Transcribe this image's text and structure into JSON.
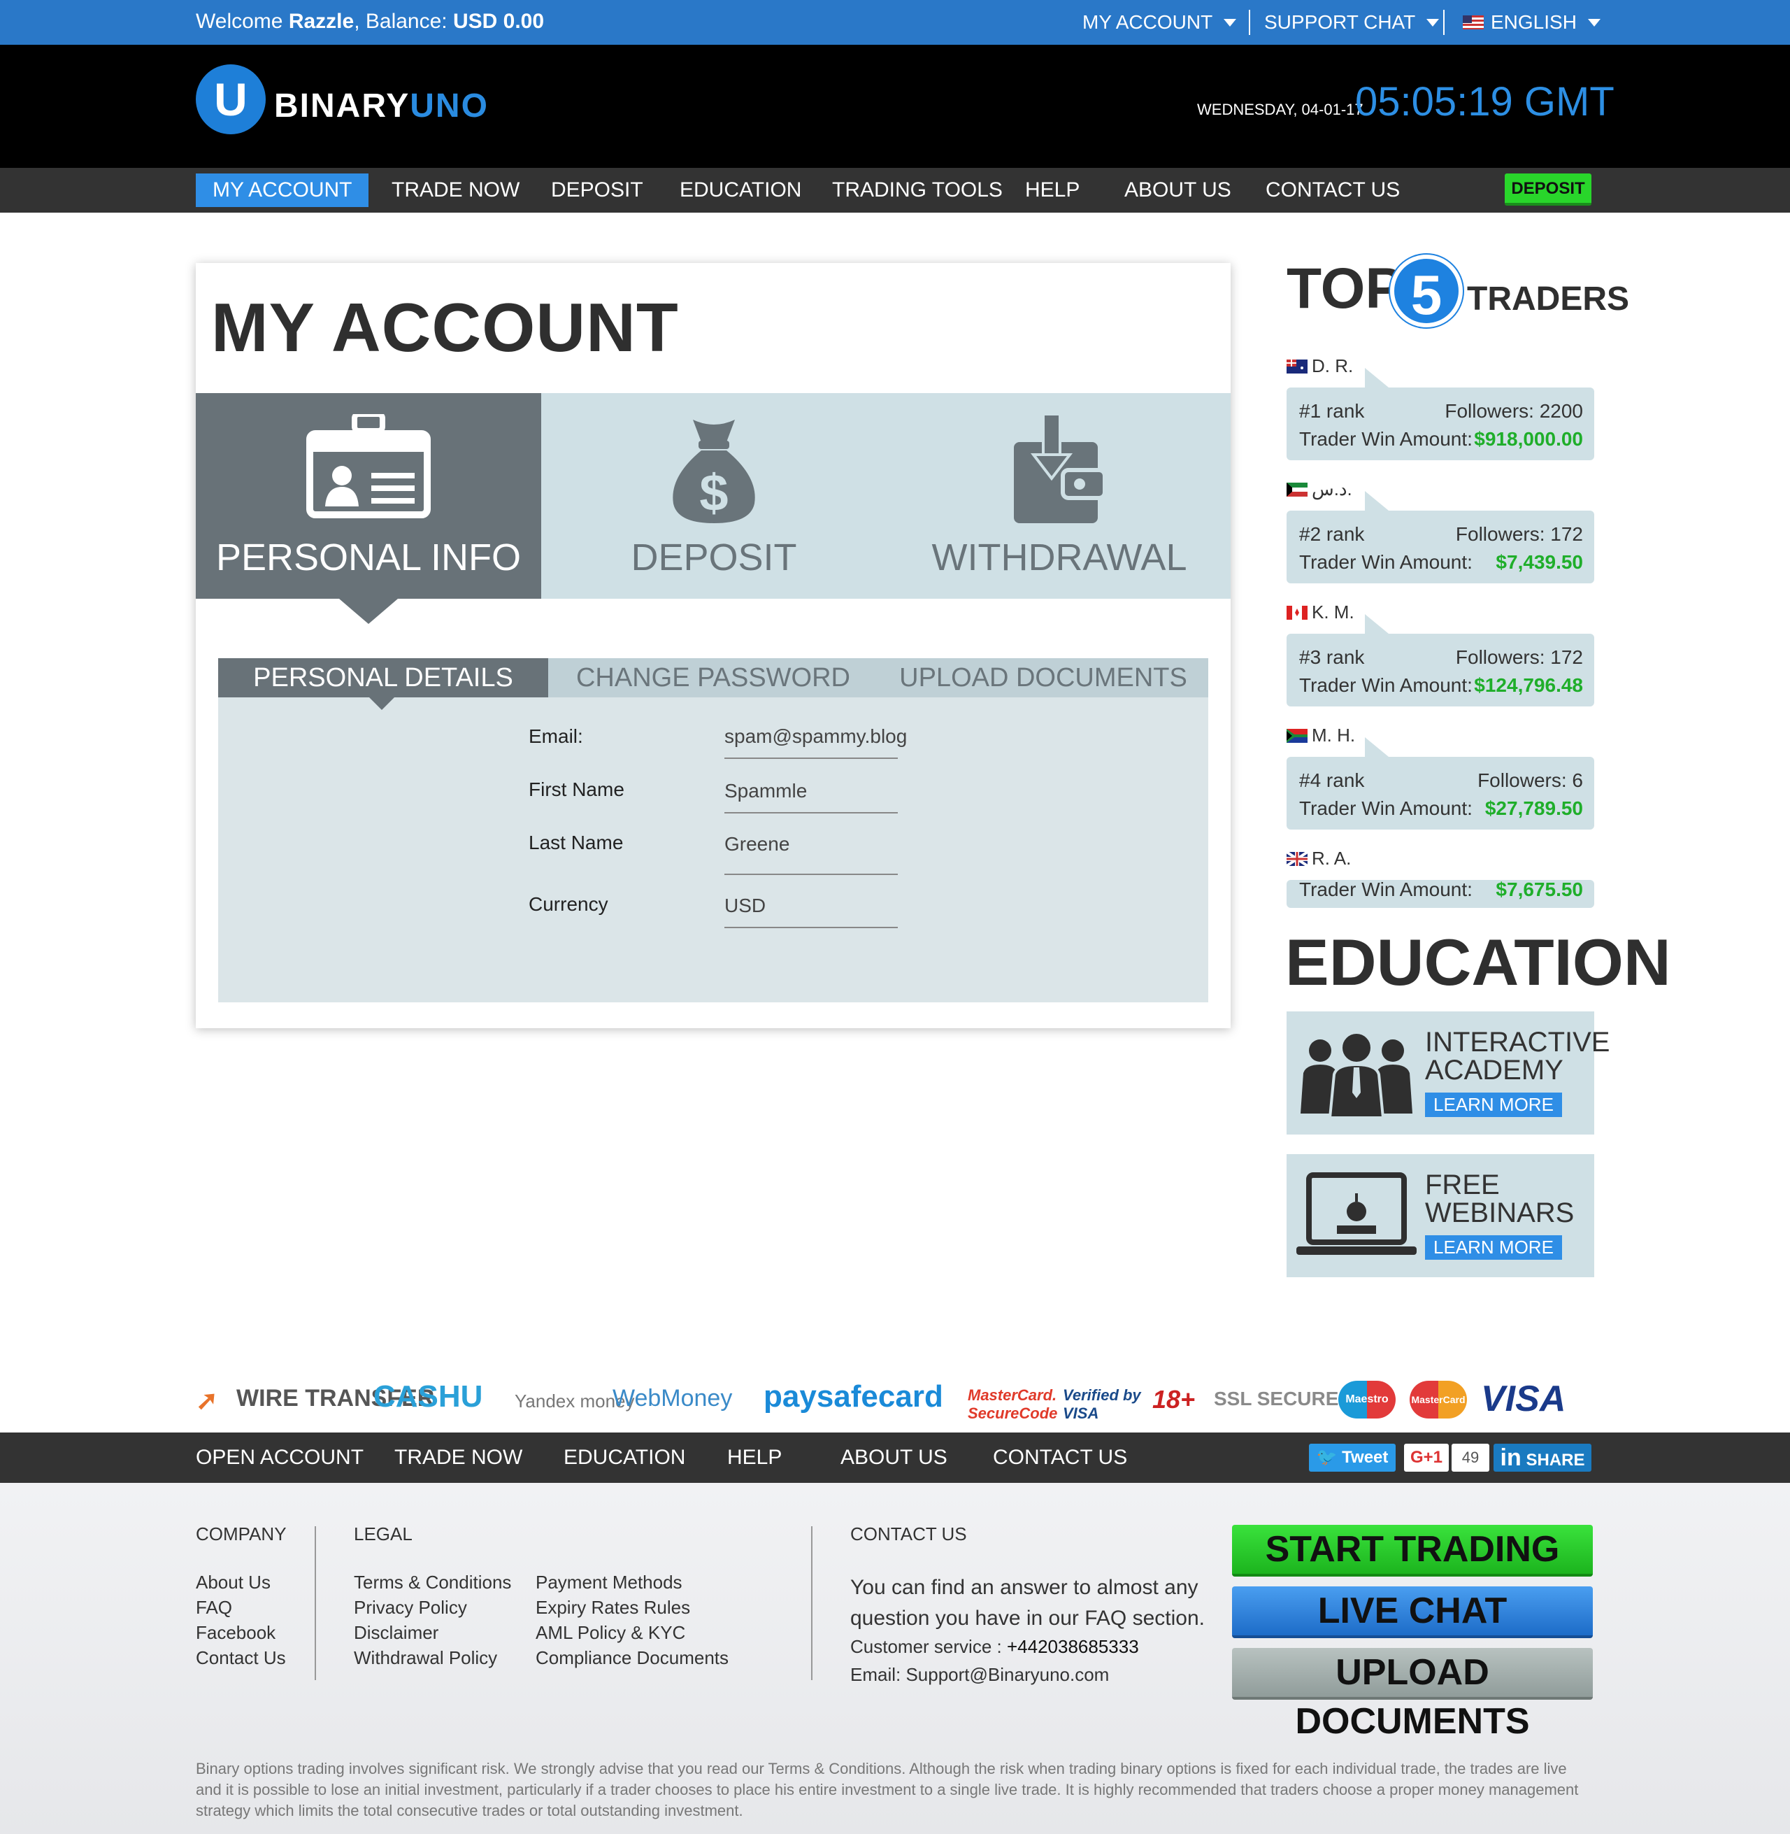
{
  "topbar": {
    "welcome_prefix": "Welcome",
    "username": "Razzle",
    "balance_label": ", Balance:",
    "balance_value": "USD 0.00",
    "my_account": "MY ACCOUNT",
    "support_chat": "SUPPORT CHAT",
    "language": "ENGLISH"
  },
  "header": {
    "logo_a": "BINARY",
    "logo_b": "UNO",
    "logo_letter": "U",
    "date": "WEDNESDAY, 04-01-17",
    "time": "05:05:19 GMT"
  },
  "nav": {
    "items": [
      "MY ACCOUNT",
      "TRADE NOW",
      "DEPOSIT",
      "EDUCATION",
      "TRADING TOOLS",
      "HELP",
      "ABOUT US",
      "CONTACT US"
    ],
    "deposit_button": "DEPOSIT"
  },
  "account": {
    "title": "MY ACCOUNT",
    "big_tabs": [
      "PERSONAL INFO",
      "DEPOSIT",
      "WITHDRAWAL"
    ],
    "sub_tabs": [
      "PERSONAL DETAILS",
      "CHANGE PASSWORD",
      "UPLOAD DOCUMENTS"
    ],
    "fields": [
      {
        "label": "Email:",
        "value": "spam@spammy.blog"
      },
      {
        "label": "First Name",
        "value": "Spammle"
      },
      {
        "label": "Last Name",
        "value": "Greene"
      },
      {
        "label": "Currency",
        "value": "USD"
      }
    ]
  },
  "top_traders": {
    "title_a": "TOP",
    "title_num": "5",
    "title_b": "TRADERS",
    "win_label": "Trader Win Amount:",
    "traders": [
      {
        "name": "D. R.",
        "rank": "#1 rank",
        "followers": "Followers: 2200",
        "amount": "$918,000.00"
      },
      {
        "name": "د.س.",
        "rank": "#2 rank",
        "followers": "Followers: 172",
        "amount": "$7,439.50"
      },
      {
        "name": "K. M.",
        "rank": "#3 rank",
        "followers": "Followers: 172",
        "amount": "$124,796.48"
      },
      {
        "name": "M. H.",
        "rank": "#4 rank",
        "followers": "Followers: 6",
        "amount": "$27,789.50"
      },
      {
        "name": "R. A.",
        "rank": "",
        "followers": "",
        "amount": "$7,675.50"
      }
    ]
  },
  "education": {
    "title": "EDUCATION",
    "items": [
      {
        "line1": "INTERACTIVE",
        "line2": "ACADEMY",
        "cta": "LEARN MORE"
      },
      {
        "line1": "FREE",
        "line2": "WEBINARS",
        "cta": "LEARN MORE"
      }
    ]
  },
  "payments": [
    "WIRE TRANSFER",
    "CASHU",
    "Yandex money",
    "WebMoney",
    "paysafecard",
    "MasterCard. SecureCode",
    "Verified by VISA",
    "18+",
    "SSL SECURE SITE",
    "Maestro",
    "MasterCard",
    "VISA"
  ],
  "footer_nav": {
    "items": [
      "OPEN ACCOUNT",
      "TRADE NOW",
      "EDUCATION",
      "HELP",
      "ABOUT US",
      "CONTACT US"
    ],
    "tweet": "Tweet",
    "gplus": "G+1",
    "gplus_count": "49",
    "share": "SHARE"
  },
  "footer": {
    "company_head": "COMPANY",
    "company_links": [
      "About Us",
      "FAQ",
      "Facebook",
      "Contact Us"
    ],
    "legal_head": "LEGAL",
    "legal_links_1": [
      "Terms & Conditions",
      "Privacy Policy",
      "Disclaimer",
      "Withdrawal Policy"
    ],
    "legal_links_2": [
      "Payment Methods",
      "Expiry Rates Rules",
      "AML Policy & KYC",
      "Compliance Documents"
    ],
    "contact_head": "CONTACT US",
    "contact_text_1": "You can find an answer to almost any",
    "contact_text_2": "question you have in our FAQ section.",
    "customer_service_label": "Customer service :",
    "customer_service_phone": "+442038685333",
    "email_line": "Email: Support@Binaryuno.com",
    "btn_start": "START TRADING",
    "btn_chat": "LIVE CHAT",
    "btn_upload": "UPLOAD DOCUMENTS",
    "disclaimer": "Binary options trading involves significant risk. We strongly advise that you read our Terms & Conditions. Although the risk when trading binary options is fixed for each individual trade, the trades are live and it is possible to lose an initial investment, particularly if a trader chooses to place his entire investment to a single live trade. It is highly recommended that traders choose a proper money management strategy which limits the total consecutive trades or total outstanding investment."
  },
  "colors": {
    "topbar": "#2a78c8",
    "accent_blue": "#2f8ee6",
    "tab_dark": "#687278",
    "tab_light": "#cfe0e5",
    "win_green": "#1fae2a",
    "cta_green": "#29d62b"
  }
}
